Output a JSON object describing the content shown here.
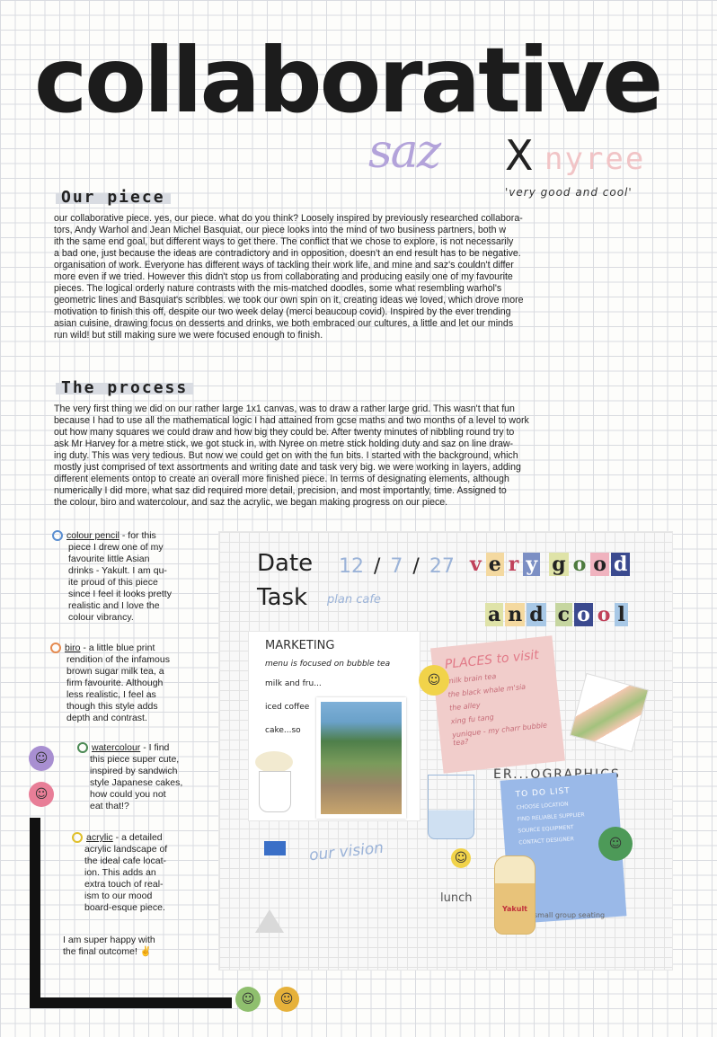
{
  "title": "collaborative",
  "authors": {
    "a": "saz",
    "x": "X",
    "b": "nyree",
    "quote": "'very good and cool'"
  },
  "sections": {
    "piece": {
      "heading": "Our piece",
      "lines": [
        "our collaborative piece. yes, our piece. what do you think? Loosely inspired by previously researched collabora-",
        "tors, Andy Warhol and Jean Michel Basquiat, our piece looks into the mind of two business partners, both w",
        "ith the same end goal, but different ways to get there. The conflict that we chose to explore, is not necessarily",
        "a bad one, just because the ideas are contradictory and in opposition, doesn't an end result has to be negative.",
        "organisation of work. Everyone has different ways of tackling their work life, and mine and saz's couldn't differ",
        "more even if we tried. However this didn't stop us from collaborating and producing easily one of my favourite",
        "pieces. The logical orderly nature contrasts with the mis-matched doodles, some what resembling warhol's",
        "geometric lines and Basquiat's scribbles. we took our own spin on it, creating ideas we loved, which drove more",
        "motivation to finish this off, despite our two week delay (merci beaucoup covid). Inspired by the ever trending",
        "asian cuisine, drawing focus on desserts and drinks, we both embraced our cultures, a little and let our minds",
        "run wild! but still making sure we were focused enough to finish."
      ]
    },
    "process": {
      "heading": "The process",
      "lines": [
        "The very first thing we did on our rather large 1x1 canvas, was to draw a rather large grid. This wasn't that fun",
        "because I had to use all the mathematical logic I had attained from gcse maths and two months of a level to work",
        "out how many squares we could draw and how big they could be. After twenty minutes of nibbling round try to",
        "ask Mr Harvey for a metre stick, we got stuck in, with Nyree on metre stick holding duty and saz on line draw-",
        "ing duty. This was very tedious. But now we could get on with the fun bits. I started with the background, which",
        "mostly just comprised of text assortments and writing date and task very big. we were working in layers, adding",
        "different elements ontop to create an overall more finished piece. In terms of designating elements, although",
        "numerically I did more, what saz did required more detail, precision, and most importantly, time. Assigned to",
        "the colour, biro and watercolour, and saz the acrylic, we began making progress on our piece."
      ]
    }
  },
  "notes": [
    {
      "key": "colour pencil",
      "color": "#5b8fd1",
      "lines": [
        "- for this",
        "piece I drew one of my",
        "favourite little Asian",
        "drinks - Yakult. I am qu-",
        "ite proud of this piece",
        "since I feel it looks pretty",
        "realistic and I love the",
        "colour vibrancy."
      ]
    },
    {
      "key": "biro",
      "color": "#e58a4f",
      "lines": [
        " - a little blue print",
        "rendition of the infamous",
        "brown sugar milk tea, a",
        "firm favourite. Although",
        "less realistic, I feel as",
        "though this style adds",
        "depth and contrast."
      ]
    },
    {
      "key": "watercolour",
      "color": "#4c8a55",
      "lines": [
        " - I find",
        "this piece super cute,",
        "inspired by sandwich",
        "style Japanese cakes,",
        "how could you not",
        "eat that!?"
      ]
    },
    {
      "key": "acrylic",
      "color": "#e0c02a",
      "lines": [
        " - a detailed",
        "acrylic landscape of",
        "the ideal cafe locat-",
        "ion. This adds an",
        "extra touch of real-",
        "ism to our mood",
        "board-esque piece."
      ]
    }
  ],
  "closing": [
    "I am super happy with",
    "the final outcome! ✌"
  ],
  "board": {
    "date_label": "Date",
    "date_value": [
      "12",
      "/",
      "7",
      "/",
      "27"
    ],
    "task_label": "Task",
    "task_value": "plan cafe",
    "cutout_line1": [
      "v",
      "e",
      "r",
      "y",
      " ",
      "g",
      "o",
      "o",
      "d"
    ],
    "cutout_line2": [
      "a",
      "n",
      "d",
      " ",
      "c",
      "o",
      "o",
      "l"
    ],
    "marketing_title": "MARKETING",
    "marketing_sub": "menu is focused on bubble tea",
    "marketing_items": [
      "milk and fru...",
      "iced coffee",
      "cake...so"
    ],
    "places_title": "PLACES to visit",
    "places_items": [
      "milk brain tea",
      "the black whale m'sia",
      "the alley",
      "xing fu tang",
      "yunique - my charr bubble tea?"
    ],
    "graphics_title": "ER...OGRAPHICS",
    "todo_title": "TO DO LIST",
    "todo_items": [
      "CHOOSE LOCATION",
      "FIND RELIABLE SUPPLIER",
      "SOURCE EQUIPMENT",
      "CONTACT DESIGNER"
    ],
    "vision": "our vision",
    "lunch": "lunch",
    "small_group": "small group seating",
    "yakult": "Yakult"
  },
  "colors": {
    "saz": "#b3a3da",
    "nyree": "#f1c4c6",
    "ink": "#222222"
  }
}
